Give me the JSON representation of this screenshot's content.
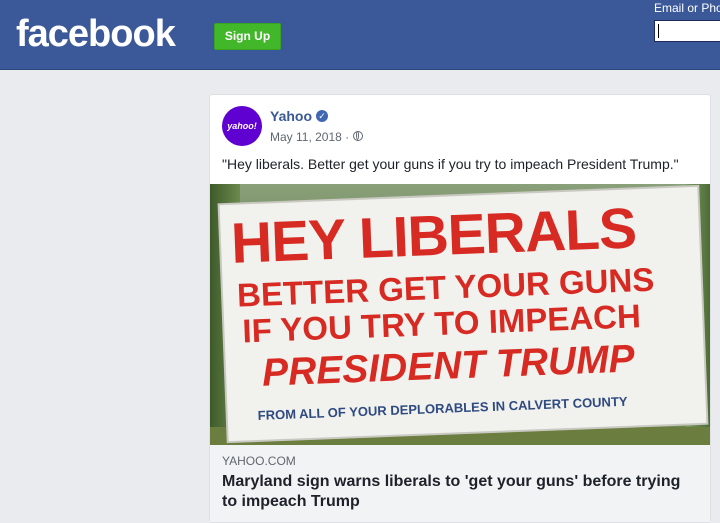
{
  "header": {
    "logo_text": "facebook",
    "signup_label": "Sign Up",
    "email_label": "Email or Phone",
    "email_value": ""
  },
  "post": {
    "avatar_text": "yahoo!",
    "page_name": "Yahoo",
    "verified_icon": "verified-badge-icon",
    "date": "May 11, 2018 ·",
    "privacy_icon": "globe-icon",
    "text": "\"Hey liberals. Better get your guns if you try to impeach President Trump.\"",
    "image": {
      "line1": "HEY LIBERALS",
      "line2": "BETTER GET YOUR GUNS",
      "line3": "IF YOU TRY TO IMPEACH",
      "line4": "PRESIDENT TRUMP",
      "line5": "FROM ALL OF YOUR DEPLORABLES IN CALVERT COUNTY"
    },
    "link": {
      "domain": "YAHOO.COM",
      "headline": "Maryland sign warns liberals to 'get your guns' before trying to impeach Trump"
    }
  },
  "colors": {
    "header_bg": "#3b5998",
    "signup_green": "#42b72a",
    "page_bg": "#e9ebee",
    "sign_red": "#d62a22"
  }
}
